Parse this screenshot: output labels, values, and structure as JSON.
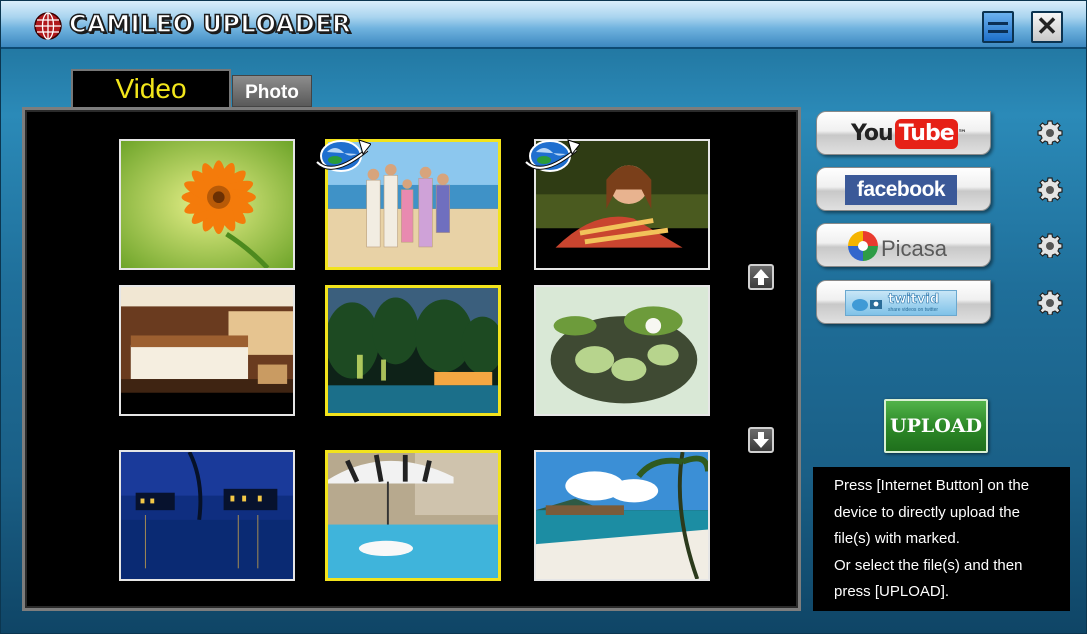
{
  "window": {
    "title": "CAMILEO UPLOADER",
    "close_glyph": "✕"
  },
  "tabs": [
    {
      "label": "Video",
      "active": true
    },
    {
      "label": "Photo",
      "active": false
    }
  ],
  "gallery": {
    "thumbnails": [
      {
        "subject": "orange-flower",
        "selected": false,
        "marked_for_upload": false
      },
      {
        "subject": "family-on-beach",
        "selected": true,
        "marked_for_upload": true
      },
      {
        "subject": "girl-on-grass",
        "selected": false,
        "marked_for_upload": true
      },
      {
        "subject": "hotel-bedroom",
        "selected": false,
        "marked_for_upload": false
      },
      {
        "subject": "resort-at-night",
        "selected": true,
        "marked_for_upload": false
      },
      {
        "subject": "vegetables-basket",
        "selected": false,
        "marked_for_upload": false
      },
      {
        "subject": "water-villas-night",
        "selected": false,
        "marked_for_upload": false
      },
      {
        "subject": "hotel-pool",
        "selected": true,
        "marked_for_upload": false
      },
      {
        "subject": "tropical-beach",
        "selected": false,
        "marked_for_upload": false
      }
    ],
    "scroll_up_icon": "arrow-up-icon",
    "scroll_down_icon": "arrow-down-icon"
  },
  "services": [
    {
      "name": "youtube",
      "logo_text_1": "You",
      "logo_text_2": "Tube",
      "trademark": "™",
      "icon": "gear-icon"
    },
    {
      "name": "facebook",
      "logo_text": "facebook",
      "icon": "gear-icon"
    },
    {
      "name": "picasa",
      "logo_text": "Picasa",
      "icon": "gear-icon"
    },
    {
      "name": "twitvid",
      "logo_text": "twitvid",
      "tagline": "share videos on twitter",
      "icon": "gear-icon"
    }
  ],
  "upload_button": {
    "label": "UPLOAD"
  },
  "info": {
    "lines": [
      "Press [Internet Button] on the",
      "device to directly upload the",
      "file(s) with marked.",
      "Or select the file(s) and then",
      "press [UPLOAD]."
    ]
  },
  "colors": {
    "selected_border": "#f2e31c",
    "active_tab_text": "#f2e61b",
    "upload_green": "#2d8a28",
    "youtube_red": "#e62117",
    "facebook_blue": "#3b5998"
  }
}
